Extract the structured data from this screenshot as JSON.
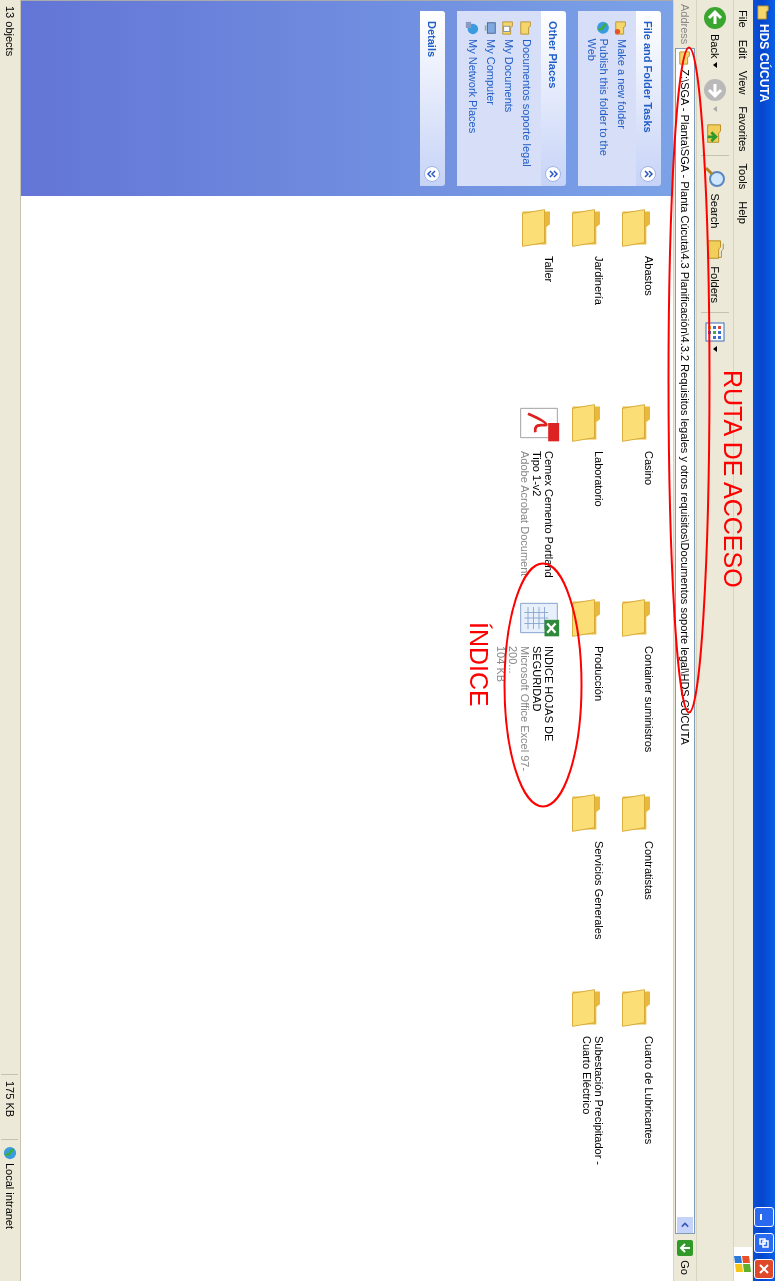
{
  "window": {
    "title": "HDS CÚCUTA"
  },
  "menu": [
    "File",
    "Edit",
    "View",
    "Favorites",
    "Tools",
    "Help"
  ],
  "toolbar": [
    {
      "kind": "back",
      "label": "Back"
    },
    {
      "kind": "forward"
    },
    {
      "kind": "up"
    },
    {
      "kind": "search",
      "label": "Search"
    },
    {
      "kind": "folders",
      "label": "Folders"
    },
    {
      "kind": "views"
    }
  ],
  "address": {
    "label": "Address",
    "value": "Z:\\SGA - Planta\\SGA - Planta Cúcuta\\4.3 Planificación\\4.3.2 Requisitos legales y otros requisitos\\Documentos soporte legal\\HDS CÚCUTA",
    "go": "Go"
  },
  "sidebar": [
    {
      "title": "File and Folder Tasks",
      "expanded": true,
      "items": [
        {
          "kind": "newfolder",
          "label": "Make a new folder"
        },
        {
          "kind": "publish",
          "label": "Publish this folder to the Web"
        }
      ]
    },
    {
      "title": "Other Places",
      "expanded": true,
      "items": [
        {
          "kind": "folder",
          "label": "Documentos soporte legal"
        },
        {
          "kind": "documents",
          "label": "My Documents"
        },
        {
          "kind": "computer",
          "label": "My Computer"
        },
        {
          "kind": "network",
          "label": "My Network Places"
        }
      ]
    },
    {
      "title": "Details",
      "expanded": false
    }
  ],
  "files": [
    {
      "kind": "folder",
      "name": "Abastos"
    },
    {
      "kind": "folder",
      "name": "Casino"
    },
    {
      "kind": "folder",
      "name": "Container suministros"
    },
    {
      "kind": "folder",
      "name": "Contratistas"
    },
    {
      "kind": "folder",
      "name": "Cuarto de Lubricantes"
    },
    {
      "kind": "folder",
      "name": "Jardinería"
    },
    {
      "kind": "folder",
      "name": "Laboratorio"
    },
    {
      "kind": "folder",
      "name": "Producción"
    },
    {
      "kind": "folder",
      "name": "Servicios Generales"
    },
    {
      "kind": "folder",
      "name": "Subestación Precipitador - Cuarto Eléctrico"
    },
    {
      "kind": "folder",
      "name": "Taller"
    },
    {
      "kind": "pdf",
      "name": "Cemex Cemento Portland Tipo 1-v2",
      "details": [
        "Adobe Acrobat Document"
      ]
    },
    {
      "kind": "excel",
      "name": "INDICE HOJAS DE SEGURIDAD",
      "details": [
        "Microsoft Office Excel 97-200...",
        "104 KB"
      ]
    }
  ],
  "annotations": [
    {
      "kind": "text",
      "text": "RUTA DE ACCESO"
    },
    {
      "kind": "text",
      "text": "ÍNDICE"
    },
    {
      "kind": "ellipse"
    },
    {
      "kind": "ellipse"
    }
  ],
  "status_bar": [
    "13 objects",
    "175 KB",
    "Local intranet"
  ]
}
